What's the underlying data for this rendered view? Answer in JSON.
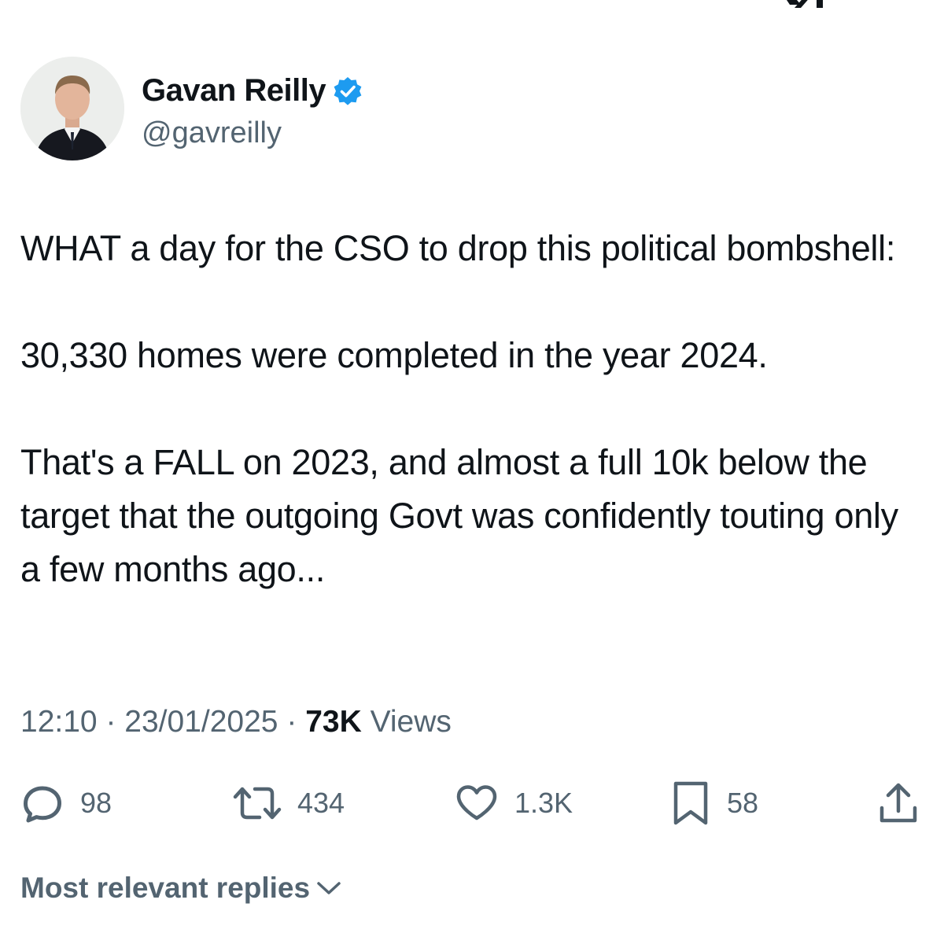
{
  "tweet": {
    "author": {
      "display_name": "Gavan Reilly",
      "handle": "@gavreilly",
      "verified": true,
      "verified_color": "#1d9bf0"
    },
    "text": "WHAT a day for the CSO to drop this political bombshell:\n\n30,330 homes were completed in the year 2024.\n\nThat's a FALL on 2023, and almost a full 10k below the target that the outgoing Govt was confidently touting only a few months ago...",
    "time": "12:10",
    "separator": "·",
    "date": "23/01/2025",
    "views_count": "73K",
    "views_label": "Views"
  },
  "actions": {
    "replies": "98",
    "retweets": "434",
    "likes": "1.3K",
    "bookmarks": "58"
  },
  "icons": {
    "reply": "speech-bubble-icon",
    "retweet": "retweet-arrows-icon",
    "like": "heart-icon",
    "bookmark": "bookmark-icon",
    "share": "share-upload-icon",
    "sort": "chevron-down-icon"
  },
  "replies_sort": {
    "label": "Most relevant replies"
  },
  "colors": {
    "text_primary": "#0f1419",
    "text_secondary": "#536471",
    "accent": "#1d9bf0"
  }
}
